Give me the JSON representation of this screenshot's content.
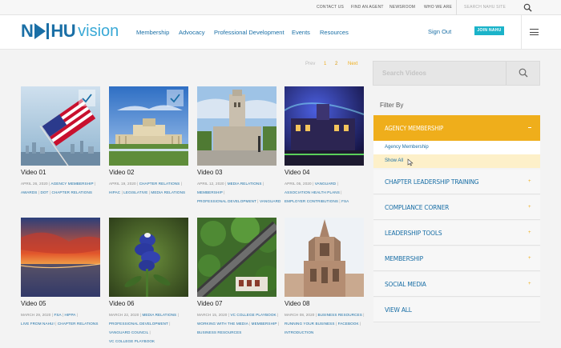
{
  "utility_bar": {
    "links": [
      "CONTACT US",
      "FIND AN AGENT",
      "NEWSROOM",
      "WHO WE ARE"
    ],
    "search_placeholder": "SEARCH NAHU SITE"
  },
  "header": {
    "logo_left": "N",
    "logo_mid": "HU",
    "logo_right": "vision",
    "nav": [
      "Membership",
      "Advocacy",
      "Professional Development",
      "Events",
      "Resources"
    ],
    "sign_out": "Sign Out",
    "join": "JOIN NAHU"
  },
  "pager": {
    "prev": "Prev",
    "pages": [
      "1",
      "2"
    ],
    "next": "Next"
  },
  "videos": [
    {
      "title": "Video 01",
      "lines": [
        [
          "APRIL 26, 2020",
          "AGENCY MEMBERSHIP"
        ],
        [
          "AWARDS",
          "DOT",
          "CHAPTER RELATIONS"
        ]
      ]
    },
    {
      "title": "Video 02",
      "lines": [
        [
          "APRIL 19, 2020",
          "CHAPTER RELATIONS"
        ],
        [
          "HIPAC",
          "LEGISLATIVE",
          "MEDIA RELATIONS"
        ]
      ]
    },
    {
      "title": "Video 03",
      "lines": [
        [
          "APRIL 12, 2020",
          "MEDIA RELATIONS"
        ],
        [
          "MEMBERSHIP"
        ],
        [
          "PROFESSIONAL DEVELOPMENT",
          "VANGUARD"
        ]
      ]
    },
    {
      "title": "Video 04",
      "lines": [
        [
          "APRIL 05, 2020",
          "VANGUARD"
        ],
        [
          "ASSOCIATION HEALTH PLANS"
        ],
        [
          "EMPLOYER CONTRIBUTIONS",
          "FSA"
        ]
      ]
    },
    {
      "title": "Video 05",
      "lines": [
        [
          "MARCH 29, 2020",
          "FSA",
          "HIPPA"
        ],
        [
          "LIVE FROM NAHU!",
          "CHAPTER RELATIONS"
        ]
      ]
    },
    {
      "title": "Video 06",
      "lines": [
        [
          "MARCH 22, 2020",
          "MEDIA RELATIONS"
        ],
        [
          "PROFESSIONAL DEVELOPMENT"
        ],
        [
          "VANGUARD COUNCIL"
        ],
        [
          "VC COLLEGE PLAYBOOK"
        ]
      ]
    },
    {
      "title": "Video 07",
      "lines": [
        [
          "MARCH 15, 2020",
          "VC COLLEGE PLAYBOOK"
        ],
        [
          "WORKING WITH THE MEDIA",
          "MEMBERSHIP"
        ],
        [
          "BUSINESS RESOURCES"
        ]
      ]
    },
    {
      "title": "Video 08",
      "lines": [
        [
          "MARCH 08, 2020",
          "BUSINESS RESOURCES"
        ],
        [
          "RUNNING YOUR BUSINESS",
          "FACEBOOK"
        ],
        [
          "INTRODUCTION"
        ]
      ]
    }
  ],
  "sidebar": {
    "search_placeholder": "Search Videos",
    "filter_by": "Filter By",
    "open_category": "AGENCY MEMBERSHIP",
    "sub_items": [
      "Agency Membership",
      "Show All"
    ],
    "categories": [
      "CHAPTER LEADERSHIP TRAINING",
      "COMPLIANCE CORNER",
      "LEADERSHIP TOOLS",
      "MEMBERSHIP",
      "SOCIAL MEDIA",
      "VIEW ALL"
    ]
  },
  "colors": {
    "brand_blue": "#1a6fa6",
    "accent_orange": "#efae1b",
    "join_teal": "#1bb3c9"
  }
}
